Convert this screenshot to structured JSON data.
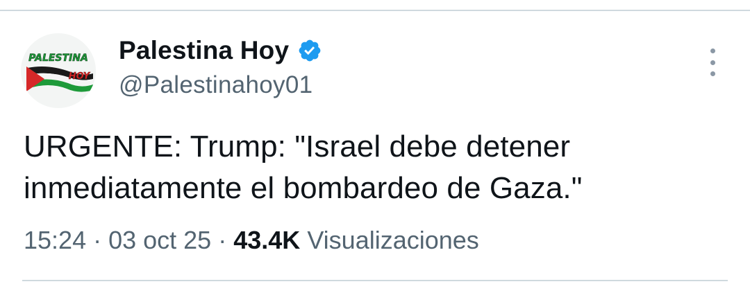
{
  "account": {
    "display_name": "Palestina Hoy",
    "handle": "@Palestinahoy01",
    "verified": true,
    "avatar_text": {
      "top": "PALESTINA",
      "bottom": "HOY"
    }
  },
  "tweet": {
    "text": "URGENTE: Trump: \"Israel debe detener inmediatamente el bombardeo de Gaza.\""
  },
  "meta": {
    "time": "15:24",
    "date": "03 oct 25",
    "separator": "·",
    "views_count": "43.4K",
    "views_label": "Visualizaciones"
  },
  "icons": {
    "verified": "verified-badge-icon",
    "more": "more-options-icon"
  },
  "colors": {
    "verified_blue": "#1d9bf0",
    "text_primary": "#0f1419",
    "text_secondary": "#536471",
    "divider": "#cfd9de"
  }
}
